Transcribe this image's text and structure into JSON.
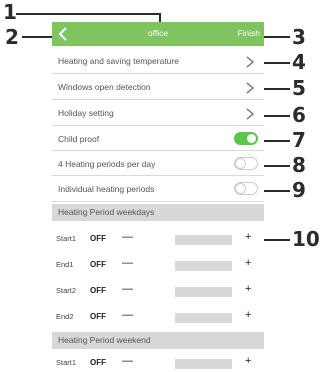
{
  "header": {
    "title": "office",
    "finish_label": "Finish"
  },
  "menu": [
    {
      "label": "Heating and saving temperature"
    },
    {
      "label": "Windows open detection"
    },
    {
      "label": "Holiday setting"
    }
  ],
  "toggles": [
    {
      "label": "Child proof",
      "state": "on"
    },
    {
      "label": "4 Heating periods per day",
      "state": "off"
    },
    {
      "label": "Individual heating periods",
      "state": "off"
    }
  ],
  "weekdays": {
    "title": "Heating Period weekdays",
    "rows": [
      {
        "label": "Start1",
        "value": "OFF",
        "minus": "—",
        "plus": "+"
      },
      {
        "label": "End1",
        "value": "OFF",
        "minus": "—",
        "plus": "+"
      },
      {
        "label": "Start2",
        "value": "OFF",
        "minus": "—",
        "plus": "+"
      },
      {
        "label": "End2",
        "value": "OFF",
        "minus": "—",
        "plus": "+"
      }
    ]
  },
  "weekend": {
    "title": "Heating Period weekend",
    "rows": [
      {
        "label": "Start1",
        "value": "OFF",
        "minus": "—",
        "plus": "+"
      }
    ]
  },
  "callouts": [
    "1",
    "2",
    "3",
    "4",
    "5",
    "6",
    "7",
    "8",
    "9",
    "10"
  ],
  "colors": {
    "accent": "#7fc45f",
    "toggle_on": "#5cc64a",
    "section_bg": "#d8d8d8"
  }
}
